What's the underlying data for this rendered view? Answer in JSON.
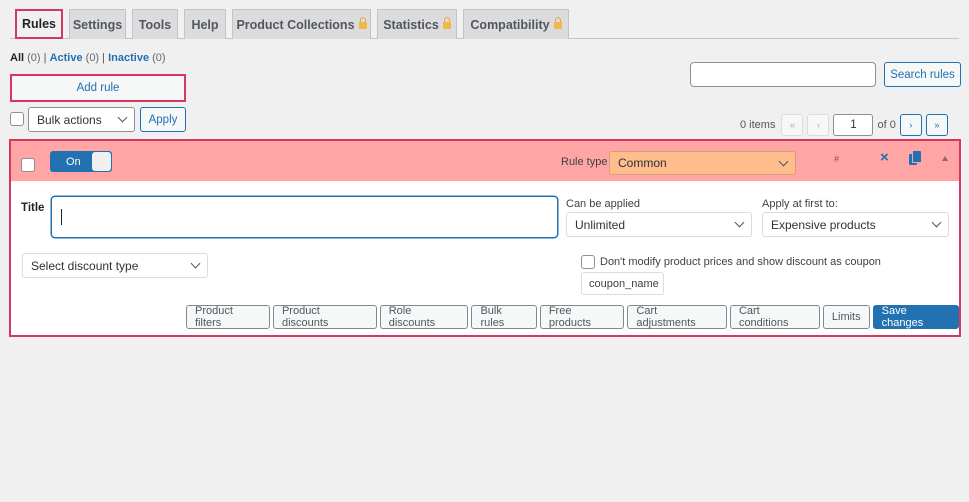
{
  "tabs": [
    {
      "label": "Rules",
      "active": true,
      "locked": false
    },
    {
      "label": "Settings",
      "active": false,
      "locked": false
    },
    {
      "label": "Tools",
      "active": false,
      "locked": false
    },
    {
      "label": "Help",
      "active": false,
      "locked": false
    },
    {
      "label": "Product Collections",
      "active": false,
      "locked": true
    },
    {
      "label": "Statistics",
      "active": false,
      "locked": true
    },
    {
      "label": "Compatibility",
      "active": false,
      "locked": true
    }
  ],
  "filters": {
    "all_label": "All",
    "all_count": "(0)",
    "active_label": "Active",
    "active_count": "(0)",
    "inactive_label": "Inactive",
    "inactive_count": "(0)",
    "separator": "|"
  },
  "add_rule_label": "Add rule",
  "bulk": {
    "selected": "Bulk actions",
    "apply_label": "Apply"
  },
  "search": {
    "value": "",
    "button_label": "Search rules"
  },
  "pagination": {
    "items_text": "0 items",
    "first": "«",
    "prev": "‹",
    "current_page": "1",
    "of_text": "of 0",
    "next": "›",
    "last": "»"
  },
  "rule": {
    "toggle_label": "On",
    "rule_type_label": "Rule type",
    "rule_type_value": "Common",
    "hash_text": "#",
    "close_icon": "×",
    "title_label": "Title",
    "title_value": "",
    "can_be_applied_label": "Can be applied",
    "can_be_applied_value": "Unlimited",
    "apply_first_label": "Apply at first to:",
    "apply_first_value": "Expensive products",
    "discount_type_value": "Select discount type",
    "coupon_checkbox_label": "Don't modify product prices and show discount as coupon",
    "coupon_placeholder": "coupon_name",
    "action_buttons": [
      "Product filters",
      "Product discounts",
      "Role discounts",
      "Bulk rules",
      "Free products",
      "Cart adjustments",
      "Cart conditions",
      "Limits"
    ],
    "save_label": "Save changes"
  },
  "colors": {
    "accent": "#2271b1",
    "highlight_border": "#d63864",
    "rule_header_bg": "#ffa5a5",
    "rule_type_bg": "#ffbc8c",
    "lock": "#f0b849"
  }
}
